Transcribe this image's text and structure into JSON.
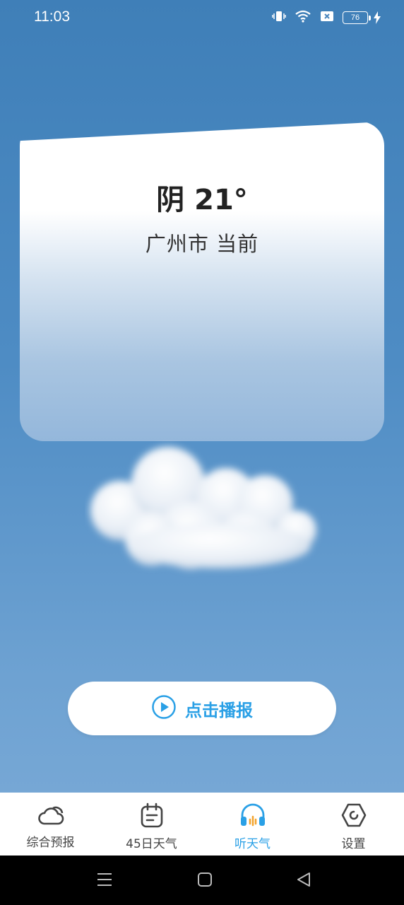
{
  "status_bar": {
    "time": "11:03",
    "battery": "76"
  },
  "weather": {
    "condition_temp": "阴 21°",
    "location": "广州市 当前"
  },
  "play_button": {
    "label": "点击播报"
  },
  "bottom_nav": {
    "items": [
      {
        "label": "综合预报",
        "icon": "cloud-icon",
        "active": false
      },
      {
        "label": "45日天气",
        "icon": "calendar-icon",
        "active": false
      },
      {
        "label": "听天气",
        "icon": "headphones-icon",
        "active": true
      },
      {
        "label": "设置",
        "icon": "settings-hexagon-icon",
        "active": false
      }
    ]
  },
  "colors": {
    "accent": "#2aa0e6",
    "sky_top": "#3f7fb8",
    "sky_bottom": "#7eacd8"
  }
}
